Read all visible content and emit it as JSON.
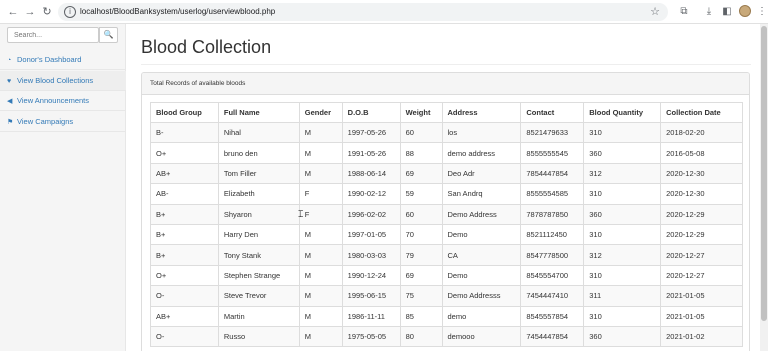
{
  "browser": {
    "url": "localhost/BloodBanksystem/userlog/userviewblood.php"
  },
  "sidebar": {
    "search_placeholder": "Search...",
    "items": [
      {
        "label": "Donor's Dashboard",
        "icon": "dashboard-icon"
      },
      {
        "label": "View Blood Collections",
        "icon": "heart-icon",
        "active": true
      },
      {
        "label": "View Announcements",
        "icon": "bullhorn-icon"
      },
      {
        "label": "View Campaigns",
        "icon": "flag-icon"
      }
    ]
  },
  "main": {
    "title": "Blood Collection",
    "panel_heading": "Total Records of available bloods",
    "columns": [
      "Blood Group",
      "Full Name",
      "Gender",
      "D.O.B",
      "Weight",
      "Address",
      "Contact",
      "Blood Quantity",
      "Collection Date"
    ],
    "rows": [
      [
        "B-",
        "Nihal",
        "M",
        "1997-05-26",
        "60",
        "los",
        "8521479633",
        "310",
        "2018-02-20"
      ],
      [
        "O+",
        "bruno den",
        "M",
        "1991-05-26",
        "88",
        "demo address",
        "8555555545",
        "360",
        "2016-05-08"
      ],
      [
        "AB+",
        "Tom Filler",
        "M",
        "1988-06-14",
        "69",
        "Deo Adr",
        "7854447854",
        "312",
        "2020-12-30"
      ],
      [
        "AB-",
        "Elizabeth",
        "F",
        "1990-02-12",
        "59",
        "San Andrq",
        "8555554585",
        "310",
        "2020-12-30"
      ],
      [
        "B+",
        "Shyaron",
        "F",
        "1996-02-02",
        "60",
        "Demo Address",
        "7878787850",
        "360",
        "2020-12-29"
      ],
      [
        "B+",
        "Harry Den",
        "M",
        "1997-01-05",
        "70",
        "Demo",
        "8521112450",
        "310",
        "2020-12-29"
      ],
      [
        "B+",
        "Tony Stank",
        "M",
        "1980-03-03",
        "79",
        "CA",
        "8547778500",
        "312",
        "2020-12-27"
      ],
      [
        "O+",
        "Stephen Strange",
        "M",
        "1990-12-24",
        "69",
        "Demo",
        "8545554700",
        "310",
        "2020-12-27"
      ],
      [
        "O-",
        "Steve Trevor",
        "M",
        "1995-06-15",
        "75",
        "Demo Addresss",
        "7454447410",
        "311",
        "2021-01-05"
      ],
      [
        "AB+",
        "Martin",
        "M",
        "1986-11-11",
        "85",
        "demo",
        "8545557854",
        "310",
        "2021-01-05"
      ],
      [
        "O-",
        "Russo",
        "M",
        "1975-05-05",
        "80",
        "demooo",
        "7454447854",
        "360",
        "2021-01-02"
      ]
    ]
  }
}
